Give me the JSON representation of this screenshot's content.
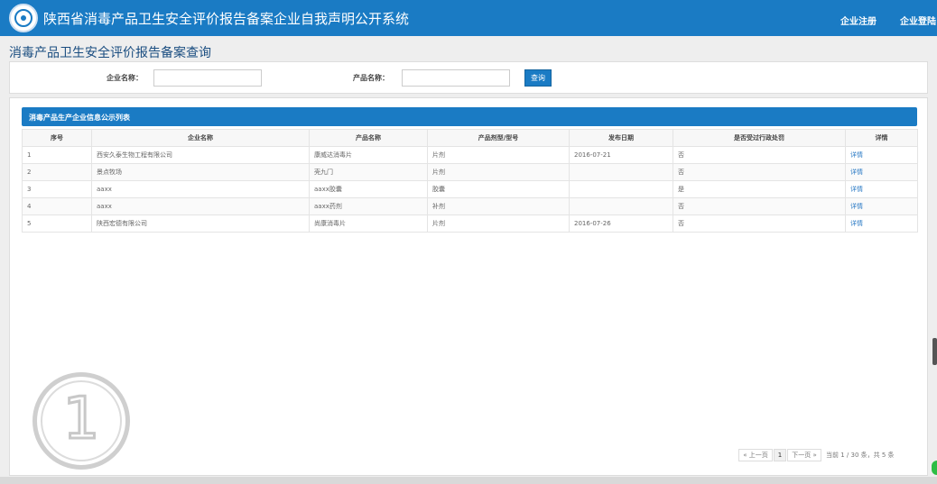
{
  "header": {
    "app_title": "陕西省消毒产品卫生安全评价报告备案企业自我声明公开系统",
    "register_label": "企业注册",
    "login_label": "企业登陆"
  },
  "page": {
    "title": "消毒产品卫生安全评价报告备案查询"
  },
  "search": {
    "company_label": "企业名称：",
    "company_value": "",
    "product_label": "产品名称：",
    "product_value": "",
    "button_label": "查询"
  },
  "list": {
    "title": "消毒产品生产企业信息公示列表",
    "columns": [
      "序号",
      "企业名称",
      "产品名称",
      "产品剂型/型号",
      "发布日期",
      "是否受过行政处罚",
      "详情"
    ],
    "rows": [
      [
        "1",
        "西安久泰生物工程有限公司",
        "康威达消毒片",
        "片剂",
        "2016-07-21",
        "否",
        "详情"
      ],
      [
        "2",
        "景点牧场",
        "壳九门",
        "片剂",
        "",
        "否",
        "详情"
      ],
      [
        "3",
        "aaxx",
        "aaxx胶囊",
        "胶囊",
        "",
        "是",
        "详情"
      ],
      [
        "4",
        "aaxx",
        "aaxx药剂",
        "补剂",
        "",
        "否",
        "详情"
      ],
      [
        "5",
        "陕西宏德有限公司",
        "尚康消毒片",
        "片剂",
        "2016-07-26",
        "否",
        "详情"
      ]
    ]
  },
  "pager": {
    "prev_label": "« 上一页",
    "current_page": "1",
    "next_label": "下一页 »",
    "info": "当前 1 / 30 条，共 5 条"
  },
  "watermark": {
    "number": "1"
  },
  "colors": {
    "brand": "#1a7bc4",
    "link": "#2a7ac5"
  }
}
